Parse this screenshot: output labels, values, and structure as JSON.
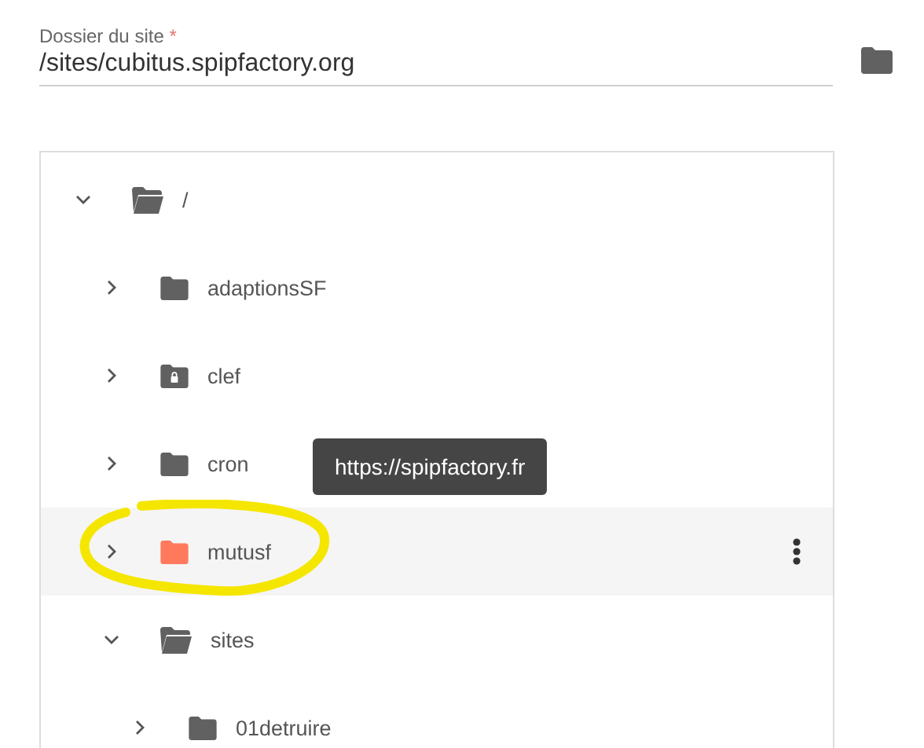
{
  "field": {
    "label": "Dossier du site",
    "required_mark": "*",
    "value": "/sites/cubitus.spipfactory.org"
  },
  "tree": [
    {
      "name": "/",
      "kind": "folder",
      "expanded": true,
      "highlighted": false,
      "children": [
        {
          "name": "adaptionsSF",
          "kind": "folder",
          "expanded": false,
          "highlighted": false
        },
        {
          "name": "clef",
          "kind": "folder-locked",
          "expanded": false,
          "highlighted": false
        },
        {
          "name": "cron",
          "kind": "folder",
          "expanded": false,
          "highlighted": false
        },
        {
          "name": "mutusf",
          "kind": "folder",
          "expanded": false,
          "highlighted": true
        },
        {
          "name": "sites",
          "kind": "folder",
          "expanded": true,
          "highlighted": false,
          "children": [
            {
              "name": "01detruire",
              "kind": "folder",
              "expanded": false,
              "highlighted": false
            }
          ]
        }
      ]
    }
  ],
  "tooltip": {
    "text": "https://spipfactory.fr"
  }
}
